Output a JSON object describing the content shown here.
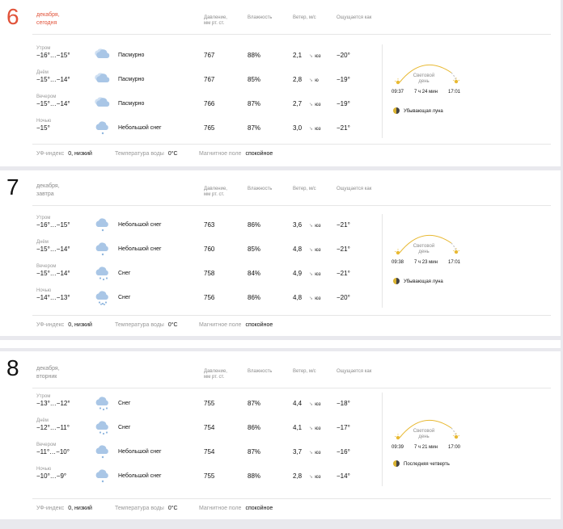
{
  "columns": {
    "pressure": "Давление,\nмм рт. ст.",
    "humidity": "Влажность",
    "wind": "Ветер, м/с",
    "feels": "Ощущается как"
  },
  "sun_label": "Световой\nдень",
  "days": [
    {
      "num": "6",
      "line1": "декабря,",
      "line2": "сегодня",
      "rows": [
        {
          "part": "Утром",
          "temp": "−16°…−15°",
          "icon": "cloudy-icon",
          "cond": "Пасмурно",
          "pres": "767",
          "hum": "88%",
          "wind": "2,1",
          "dir": "юз",
          "feels": "−20°"
        },
        {
          "part": "Днём",
          "temp": "−15°…−14°",
          "icon": "cloudy-icon",
          "cond": "Пасмурно",
          "pres": "767",
          "hum": "85%",
          "wind": "2,8",
          "dir": "ю",
          "feels": "−19°"
        },
        {
          "part": "Вечером",
          "temp": "−15°…−14°",
          "icon": "cloudy-icon",
          "cond": "Пасмурно",
          "pres": "766",
          "hum": "87%",
          "wind": "2,7",
          "dir": "юз",
          "feels": "−19°"
        },
        {
          "part": "Ночью",
          "temp": "−15°",
          "icon": "light-snow-icon",
          "cond": "Небольшой снег",
          "pres": "765",
          "hum": "87%",
          "wind": "3,0",
          "dir": "юз",
          "feels": "−21°"
        }
      ],
      "sunrise": "09:37",
      "daylen": "7 ч 24 мин",
      "sunset": "17:01",
      "moon": "Убывающая луна",
      "uv_label": "УФ-индекс",
      "uv": "0, низкий",
      "water_label": "Температура воды",
      "water": "0°C",
      "mag_label": "Магнитное поле",
      "mag": "спокойное"
    },
    {
      "num": "7",
      "line1": "декабря,",
      "line2": "завтра",
      "rows": [
        {
          "part": "Утром",
          "temp": "−16°…−15°",
          "icon": "light-snow-icon",
          "cond": "Небольшой снег",
          "pres": "763",
          "hum": "86%",
          "wind": "3,6",
          "dir": "юз",
          "feels": "−21°"
        },
        {
          "part": "Днём",
          "temp": "−15°…−14°",
          "icon": "light-snow-icon",
          "cond": "Небольшой снег",
          "pres": "760",
          "hum": "85%",
          "wind": "4,8",
          "dir": "юз",
          "feels": "−21°"
        },
        {
          "part": "Вечером",
          "temp": "−15°…−14°",
          "icon": "snow-icon",
          "cond": "Снег",
          "pres": "758",
          "hum": "84%",
          "wind": "4,9",
          "dir": "юз",
          "feels": "−21°"
        },
        {
          "part": "Ночью",
          "temp": "−14°…−13°",
          "icon": "heavy-snow-icon",
          "cond": "Снег",
          "pres": "756",
          "hum": "86%",
          "wind": "4,8",
          "dir": "юз",
          "feels": "−20°"
        }
      ],
      "sunrise": "09:38",
      "daylen": "7 ч 23 мин",
      "sunset": "17:01",
      "moon": "Убывающая луна",
      "uv_label": "УФ-индекс",
      "uv": "0, низкий",
      "water_label": "Температура воды",
      "water": "0°C",
      "mag_label": "Магнитное поле",
      "mag": "спокойное"
    },
    {
      "num": "8",
      "line1": "декабря,",
      "line2": "вторник",
      "rows": [
        {
          "part": "Утром",
          "temp": "−13°…−12°",
          "icon": "snow-icon",
          "cond": "Снег",
          "pres": "755",
          "hum": "87%",
          "wind": "4,4",
          "dir": "юз",
          "feels": "−18°"
        },
        {
          "part": "Днём",
          "temp": "−12°…−11°",
          "icon": "snow-icon",
          "cond": "Снег",
          "pres": "754",
          "hum": "86%",
          "wind": "4,1",
          "dir": "юз",
          "feels": "−17°"
        },
        {
          "part": "Вечером",
          "temp": "−11°…−10°",
          "icon": "light-snow-icon",
          "cond": "Небольшой снег",
          "pres": "754",
          "hum": "87%",
          "wind": "3,7",
          "dir": "юз",
          "feels": "−16°"
        },
        {
          "part": "Ночью",
          "temp": "−10°…−9°",
          "icon": "light-snow-icon",
          "cond": "Небольшой снег",
          "pres": "755",
          "hum": "88%",
          "wind": "2,8",
          "dir": "юз",
          "feels": "−14°"
        }
      ],
      "sunrise": "09:39",
      "daylen": "7 ч 21 мин",
      "sunset": "17:00",
      "moon": "Последняя четверть",
      "uv_label": "УФ-индекс",
      "uv": "0, низкий",
      "water_label": "Температура воды",
      "water": "0°C",
      "mag_label": "Магнитное поле",
      "mag": "спокойное"
    }
  ]
}
